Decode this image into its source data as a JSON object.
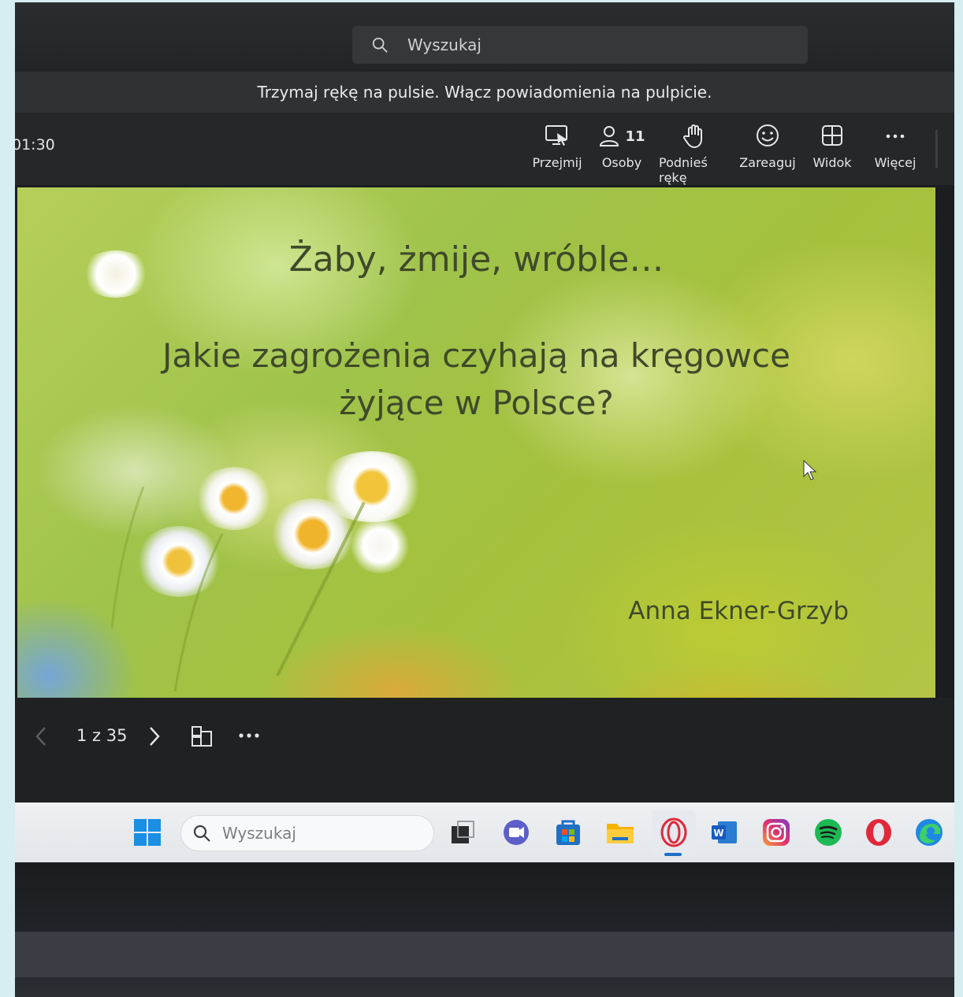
{
  "meeting": {
    "search_placeholder": "Wyszukaj",
    "banner": "Trzymaj rękę na pulsie. Włącz powiadomienia na pulpicie.",
    "timer": "01:30",
    "toolbar": [
      {
        "label": "Przejmij",
        "icon": "take-control-icon"
      },
      {
        "label": "Osoby",
        "icon": "people-icon",
        "count": "11"
      },
      {
        "label": "Podnieś rękę",
        "icon": "raise-hand-icon"
      },
      {
        "label": "Zareaguj",
        "icon": "react-icon"
      },
      {
        "label": "Widok",
        "icon": "view-icon"
      },
      {
        "label": "Więcej",
        "icon": "more-icon"
      }
    ]
  },
  "slide": {
    "title": "Żaby, żmije, wróble…",
    "question_line1": "Jakie zagrożenia czyhają na kręgowce",
    "question_line2": "żyjące w Polsce?",
    "author": "Anna Ekner-Grzyb"
  },
  "slide_nav": {
    "pager": "1 z 35"
  },
  "taskbar": {
    "search_placeholder": "Wyszukaj",
    "apps": [
      "windows-start-icon",
      "task-view-icon",
      "chat-icon",
      "store-icon",
      "file-explorer-icon",
      "opera-gx-icon",
      "word-icon",
      "instagram-icon",
      "spotify-icon",
      "opera-icon",
      "edge-icon"
    ]
  },
  "colors": {
    "accent_opera": "#e0283a",
    "spotify": "#1db954",
    "edge": "#1e88e5"
  }
}
